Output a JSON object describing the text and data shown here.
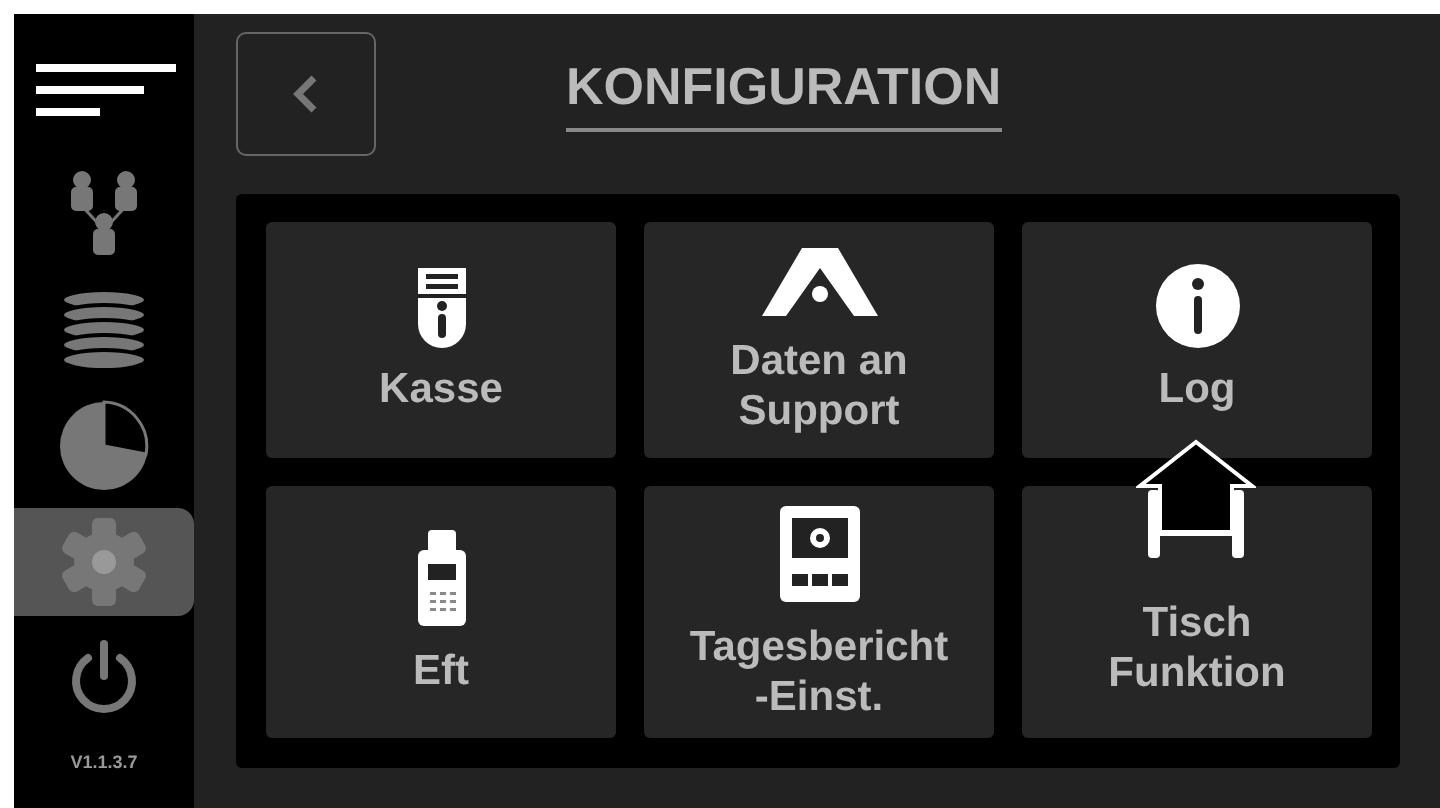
{
  "sidebar": {
    "items": [
      {
        "kind": "network",
        "selected": false
      },
      {
        "kind": "database",
        "selected": false
      },
      {
        "kind": "chart",
        "selected": false
      },
      {
        "kind": "settings",
        "selected": true
      },
      {
        "kind": "power",
        "selected": false
      }
    ],
    "version": "V1.1.3.7"
  },
  "title": "KONFIGURATION",
  "tiles": [
    {
      "kind": "register",
      "label": "Kasse"
    },
    {
      "kind": "logo",
      "label": "Daten an Support"
    },
    {
      "kind": "info",
      "label": "Log"
    },
    {
      "kind": "terminal",
      "label": "Eft"
    },
    {
      "kind": "report",
      "label": "Tagesbericht -Einst."
    },
    {
      "kind": "table",
      "label": "Tisch Funktion"
    }
  ]
}
